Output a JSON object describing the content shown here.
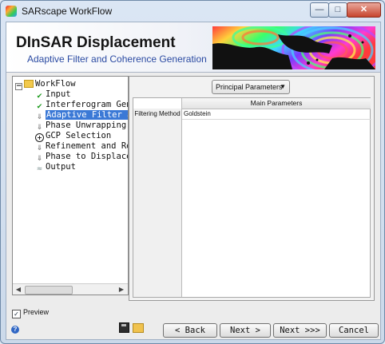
{
  "window": {
    "title": "SARscape WorkFlow",
    "min_glyph": "—",
    "max_glyph": "□",
    "close_glyph": "✕"
  },
  "header": {
    "title": "DInSAR Displacement",
    "subtitle": "Adaptive Filter and Coherence Generation"
  },
  "workflow": {
    "root_label": "WorkFlow",
    "items": [
      {
        "label": "Input",
        "status": "done"
      },
      {
        "label": "Interferogram Gener",
        "status": "done"
      },
      {
        "label": "Adaptive Filter a",
        "status": "current"
      },
      {
        "label": "Phase Unwrapping",
        "status": "pending"
      },
      {
        "label": "GCP Selection",
        "status": "gcp"
      },
      {
        "label": "Refinement and Re",
        "status": "pending"
      },
      {
        "label": "Phase to Displace",
        "status": "pending"
      },
      {
        "label": "Output",
        "status": "output"
      }
    ]
  },
  "parameters": {
    "dropdown_value": "Principal Parameters",
    "column_header": "Main Parameters",
    "rows": [
      {
        "name": "Filtering Method",
        "value": "Goldstein"
      }
    ]
  },
  "footer": {
    "preview_label": "Preview",
    "preview_checked": true,
    "help_glyph": "?",
    "back_label": "< Back",
    "next_label": "Next >",
    "next_all_label": "Next >>>",
    "cancel_label": "Cancel"
  },
  "glyphs": {
    "check": "✔",
    "pending": "⇓",
    "gcp": "+",
    "output": "≈",
    "collapse": "−",
    "tree_arrow_left": "◀",
    "tree_arrow_right": "▶",
    "dropdown_arrow": "▼"
  },
  "colors": {
    "selection": "#3b79d6",
    "subtitle": "#2a4aa2",
    "check": "#1d9a1d"
  }
}
